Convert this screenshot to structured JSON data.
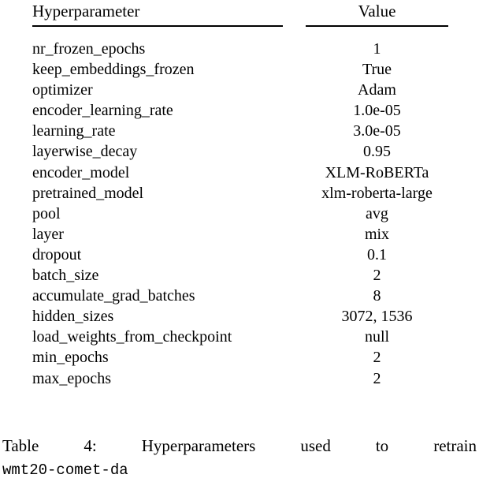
{
  "table": {
    "columns": {
      "parameter": "Hyperparameter",
      "value": "Value"
    },
    "rows": [
      {
        "parameter": "nr_frozen_epochs",
        "value": "1"
      },
      {
        "parameter": "keep_embeddings_frozen",
        "value": "True"
      },
      {
        "parameter": "optimizer",
        "value": "Adam"
      },
      {
        "parameter": "encoder_learning_rate",
        "value": "1.0e-05"
      },
      {
        "parameter": "learning_rate",
        "value": "3.0e-05"
      },
      {
        "parameter": "layerwise_decay",
        "value": "0.95"
      },
      {
        "parameter": "encoder_model",
        "value": "XLM-RoBERTa"
      },
      {
        "parameter": "pretrained_model",
        "value": "xlm-roberta-large"
      },
      {
        "parameter": "pool",
        "value": "avg"
      },
      {
        "parameter": "layer",
        "value": "mix"
      },
      {
        "parameter": "dropout",
        "value": "0.1"
      },
      {
        "parameter": "batch_size",
        "value": "2"
      },
      {
        "parameter": "accumulate_grad_batches",
        "value": "8"
      },
      {
        "parameter": "hidden_sizes",
        "value": "3072, 1536"
      },
      {
        "parameter": "load_weights_from_checkpoint",
        "value": "null"
      },
      {
        "parameter": "min_epochs",
        "value": "2"
      },
      {
        "parameter": "max_epochs",
        "value": "2"
      }
    ]
  },
  "caption": {
    "line1_words": [
      "Table",
      "4:",
      "Hyperparameters",
      "used",
      "to",
      "retrain"
    ],
    "line2": "wmt20-comet-da"
  }
}
